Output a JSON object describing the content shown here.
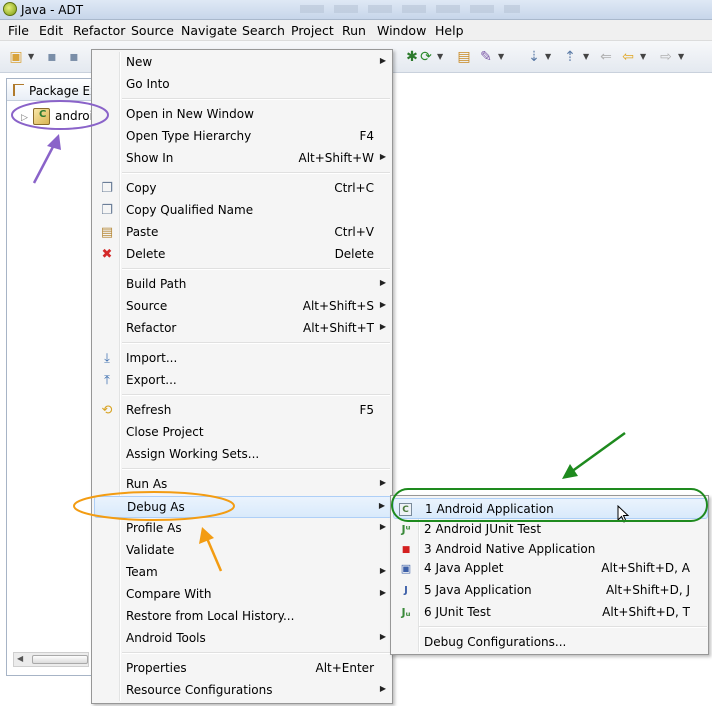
{
  "window": {
    "title": "Java - ADT"
  },
  "menubar": [
    "File",
    "Edit",
    "Refactor",
    "Source",
    "Navigate",
    "Search",
    "Project",
    "Run",
    "Window",
    "Help"
  ],
  "package_explorer": {
    "title": "Package Exp",
    "project_label": "androi"
  },
  "context_menu": {
    "new": {
      "label": "New"
    },
    "go_into": {
      "label": "Go Into"
    },
    "open_new_window": {
      "label": "Open in New Window"
    },
    "open_type_hierarchy": {
      "label": "Open Type Hierarchy",
      "shortcut": "F4"
    },
    "show_in": {
      "label": "Show In",
      "shortcut": "Alt+Shift+W"
    },
    "copy": {
      "label": "Copy",
      "shortcut": "Ctrl+C"
    },
    "copy_qualified": {
      "label": "Copy Qualified Name"
    },
    "paste": {
      "label": "Paste",
      "shortcut": "Ctrl+V"
    },
    "delete": {
      "label": "Delete",
      "shortcut": "Delete"
    },
    "build_path": {
      "label": "Build Path"
    },
    "source": {
      "label": "Source",
      "shortcut": "Alt+Shift+S"
    },
    "refactor": {
      "label": "Refactor",
      "shortcut": "Alt+Shift+T"
    },
    "import": {
      "label": "Import..."
    },
    "export": {
      "label": "Export..."
    },
    "refresh": {
      "label": "Refresh",
      "shortcut": "F5"
    },
    "close_project": {
      "label": "Close Project"
    },
    "assign_working_sets": {
      "label": "Assign Working Sets..."
    },
    "run_as": {
      "label": "Run As"
    },
    "debug_as": {
      "label": "Debug As"
    },
    "profile_as": {
      "label": "Profile As"
    },
    "validate": {
      "label": "Validate"
    },
    "team": {
      "label": "Team"
    },
    "compare_with": {
      "label": "Compare With"
    },
    "restore_history": {
      "label": "Restore from Local History..."
    },
    "android_tools": {
      "label": "Android Tools"
    },
    "properties": {
      "label": "Properties",
      "shortcut": "Alt+Enter"
    },
    "resource_configurations": {
      "label": "Resource Configurations"
    }
  },
  "debug_submenu": {
    "android_app": {
      "label": "1 Android Application"
    },
    "android_junit": {
      "label": "2 Android JUnit Test"
    },
    "android_native": {
      "label": "3 Android Native Application"
    },
    "java_applet": {
      "label": "4 Java Applet",
      "shortcut": "Alt+Shift+D, A"
    },
    "java_application": {
      "label": "5 Java Application",
      "shortcut": "Alt+Shift+D, J"
    },
    "junit_test": {
      "label": "6 JUnit Test",
      "shortcut": "Alt+Shift+D, T"
    },
    "debug_configurations": {
      "label": "Debug Configurations..."
    }
  },
  "colors": {
    "annotation_purple": "#8a63c9",
    "annotation_orange": "#f39c12",
    "annotation_green": "#1e8a1e",
    "highlight": "#d9eafb"
  }
}
